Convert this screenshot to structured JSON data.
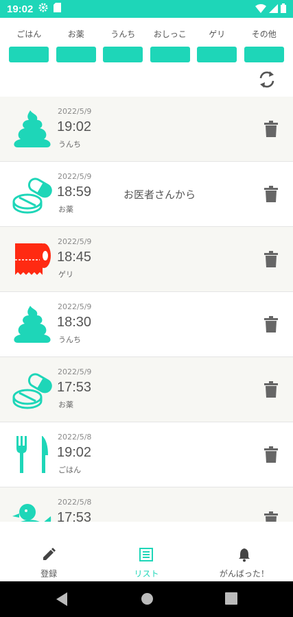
{
  "status_bar": {
    "time": "19:02"
  },
  "categories": [
    {
      "label": "ごはん"
    },
    {
      "label": "お薬"
    },
    {
      "label": "うんち"
    },
    {
      "label": "おしっこ"
    },
    {
      "label": "ゲリ"
    },
    {
      "label": "その他"
    }
  ],
  "records": [
    {
      "icon": "poop-icon",
      "date": "2022/5/9",
      "time": "19:02",
      "kind": "うんち",
      "note": ""
    },
    {
      "icon": "pill-icon",
      "date": "2022/5/9",
      "time": "18:59",
      "kind": "お薬",
      "note": "お医者さんから"
    },
    {
      "icon": "toilet-paper-icon",
      "date": "2022/5/9",
      "time": "18:45",
      "kind": "ゲリ",
      "note": ""
    },
    {
      "icon": "poop-icon",
      "date": "2022/5/9",
      "time": "18:30",
      "kind": "うんち",
      "note": ""
    },
    {
      "icon": "pill-icon",
      "date": "2022/5/9",
      "time": "17:53",
      "kind": "お薬",
      "note": ""
    },
    {
      "icon": "fork-knife-icon",
      "date": "2022/5/8",
      "time": "19:02",
      "kind": "ごはん",
      "note": ""
    },
    {
      "icon": "duck-icon",
      "date": "2022/5/8",
      "time": "17:53",
      "kind": "",
      "note": ""
    }
  ],
  "bottom_nav": {
    "register": "登録",
    "list": "リスト",
    "cheer": "がんばった！"
  },
  "colors": {
    "accent": "#1ed6b8",
    "diarrhea": "#ff2a12"
  }
}
